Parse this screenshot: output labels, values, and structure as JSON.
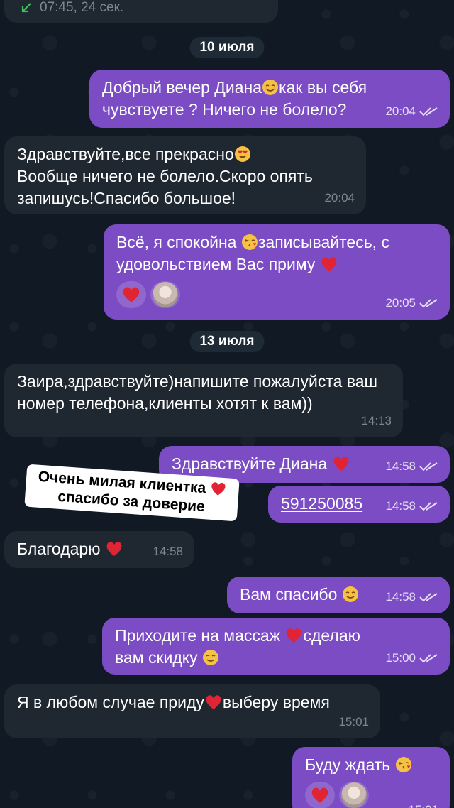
{
  "colors": {
    "background": "#111a24",
    "incoming_bubble": "#1f2731",
    "outgoing_bubble": "#7b4cc4",
    "date_pill": "#1e2a36",
    "heart": "#e02434",
    "call_icon": "#3fbf5c"
  },
  "top_call": {
    "icon": "arrow-down-left-icon",
    "text": "07:45, 24 сек."
  },
  "dates": [
    "10 июля",
    "13 июля"
  ],
  "messages": [
    {
      "dir": "out",
      "text": "Добрый вечер Диана",
      "emoji_after": "smiling-face-icon",
      "text2": "как вы себя чувствуете ? Ничего не болело?",
      "time": "20:04"
    },
    {
      "dir": "in",
      "line1": "Здравствуйте,все прекрасно",
      "line1_emoji": "heart-eyes-icon",
      "rest": "Вообще ничего не болело.Скоро опять запишусь!Спасибо большое!",
      "time": "20:04"
    },
    {
      "dir": "out",
      "text_a": "Всё,  я спокойна ",
      "emoji_a": "kiss-face-icon",
      "text_b": "записывайтесь, с удовольствием Вас приму ",
      "emoji_b": "red-heart-icon",
      "reactions": [
        "red-heart-icon",
        "avatar"
      ],
      "time": "20:05"
    },
    {
      "dir": "in",
      "text": "Заира,здравствуйте)напишите пожалуйста ваш номер телефона,клиенты хотят к вам))",
      "time": "14:13"
    },
    {
      "dir": "out",
      "text": "Здравствуйте Диана ",
      "emoji": "red-heart-icon",
      "time": "14:58"
    },
    {
      "dir": "out",
      "text": "591250085",
      "time": "14:58"
    },
    {
      "dir": "in",
      "text": "Благодарю ",
      "emoji": "red-heart-icon",
      "time": "14:58"
    },
    {
      "dir": "out",
      "text": "Вам спасибо ",
      "emoji": "smiling-face-icon",
      "time": "14:58"
    },
    {
      "dir": "out",
      "text_a": "Приходите на массаж ",
      "emoji_a": "red-heart-icon",
      "text_b": "сделаю вам скидку ",
      "emoji_b": "smiling-face-icon",
      "time": "15:00"
    },
    {
      "dir": "in",
      "text_a": "Я в любом случае приду",
      "emoji_a": "red-heart-icon",
      "text_b": "выберу время",
      "time": "15:01"
    },
    {
      "dir": "out",
      "text": "Буду ждать ",
      "emoji": "kiss-face-icon",
      "reactions": [
        "red-heart-icon",
        "avatar"
      ],
      "time": "15:01"
    }
  ],
  "sticker": {
    "line1": "Очень милая клиентка",
    "line2": "спасибо за доверие",
    "emoji": "red-heart-icon"
  }
}
